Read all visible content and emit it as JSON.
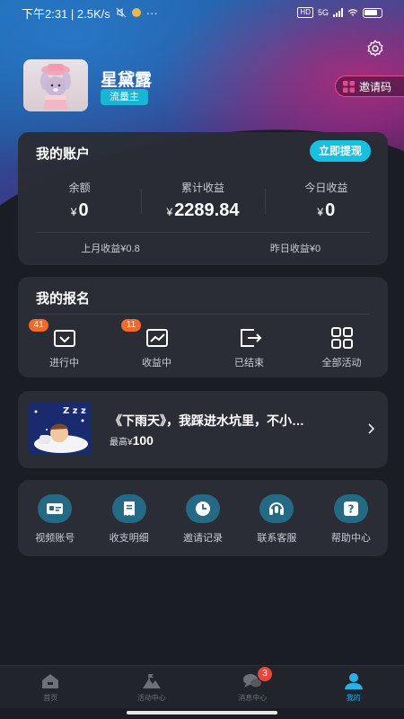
{
  "status_bar": {
    "time_speed": "下午2:31 | 2.5K/s",
    "more": "···",
    "hd_badge": "HD",
    "network": "5G"
  },
  "profile": {
    "username": "星黛露",
    "role_badge": "流量主",
    "invite_label": "邀请码"
  },
  "account": {
    "title": "我的账户",
    "withdraw_label": "立即提现",
    "currency": "¥",
    "stats": [
      {
        "label": "余额",
        "value": "0"
      },
      {
        "label": "累计收益",
        "value": "2289.84"
      },
      {
        "label": "今日收益",
        "value": "0"
      }
    ],
    "last_month": "上月收益¥0.8",
    "yesterday": "昨日收益¥0"
  },
  "signup": {
    "title": "我的报名",
    "items": [
      {
        "label": "进行中",
        "badge": "41"
      },
      {
        "label": "收益中",
        "badge": "11"
      },
      {
        "label": "已结束"
      },
      {
        "label": "全部活动"
      }
    ]
  },
  "task": {
    "title": "《下雨天》，我踩进水坑里，不小…",
    "max_prefix": "最高",
    "currency": "¥",
    "max_value": "100",
    "thumb_text": "Z z z"
  },
  "tools": {
    "items": [
      {
        "label": "视频账号",
        "icon": "id-card-icon"
      },
      {
        "label": "收支明细",
        "icon": "receipt-icon"
      },
      {
        "label": "邀请记录",
        "icon": "clock-icon"
      },
      {
        "label": "联系客服",
        "icon": "headset-icon"
      },
      {
        "label": "帮助中心",
        "icon": "help-icon"
      }
    ]
  },
  "tabbar": {
    "items": [
      {
        "label": "首页",
        "icon": "home-icon"
      },
      {
        "label": "活动中心",
        "icon": "mountain-icon"
      },
      {
        "label": "消息中心",
        "icon": "chat-icon",
        "badge": "3"
      },
      {
        "label": "我的",
        "icon": "person-icon",
        "active": true
      }
    ]
  },
  "colors": {
    "accent": "#18c0df",
    "badge_orange": "#f06a2a",
    "badge_red": "#e8453c",
    "card_bg": "#2a2d35",
    "page_bg": "#1b1d24"
  }
}
